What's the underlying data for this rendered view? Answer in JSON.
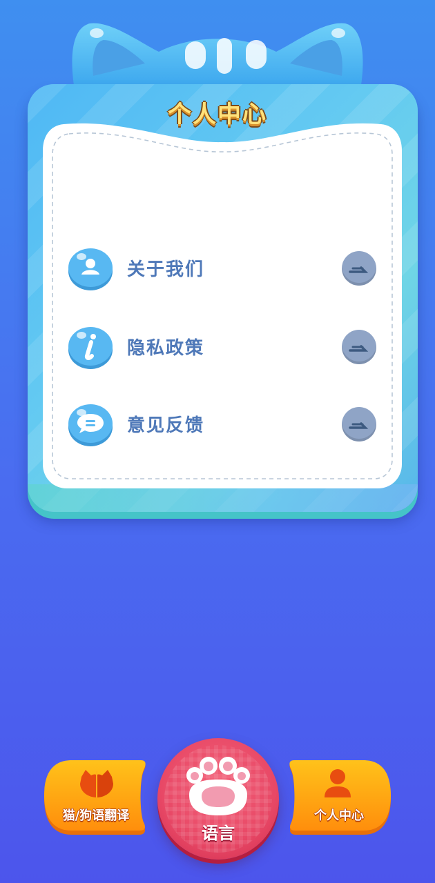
{
  "page": {
    "title": "个人中心"
  },
  "menu": {
    "items": [
      {
        "label": "关于我们",
        "icon": "user-icon"
      },
      {
        "label": "隐私政策",
        "icon": "info-icon"
      },
      {
        "label": "意见反馈",
        "icon": "chat-icon"
      }
    ]
  },
  "tabbar": {
    "left_label": "猫/狗语翻译",
    "center_label": "语言",
    "right_label": "个人中心"
  },
  "colors": {
    "background_top": "#3f8ff0",
    "background_bottom": "#4c55ec",
    "card": "#5fc3f3",
    "label": "#4e78b8",
    "tab_orange": "#ff9b12",
    "tab_red": "#e84866"
  }
}
